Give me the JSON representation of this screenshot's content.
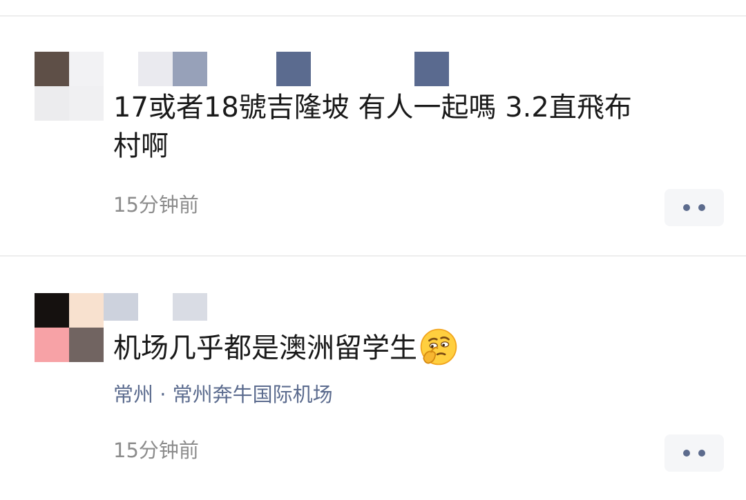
{
  "posts": [
    {
      "content_line1": "17或者18號吉隆坡 有人一起嗎 3.2直飛布",
      "content_line2": "村啊",
      "time": "15分钟前",
      "more_icon": "more-dots-icon"
    },
    {
      "content": "机场几乎都是澳洲留学生",
      "emoji": "thinking-face-icon",
      "location": "常州 · 常州奔牛国际机场",
      "time": "15分钟前",
      "more_icon": "more-dots-icon"
    }
  ],
  "colors": {
    "text": "#1a1a1a",
    "meta": "#8c8c8c",
    "location": "#5b6b8e",
    "dots": "#5c6b8d",
    "button_bg": "#f5f6f8"
  }
}
